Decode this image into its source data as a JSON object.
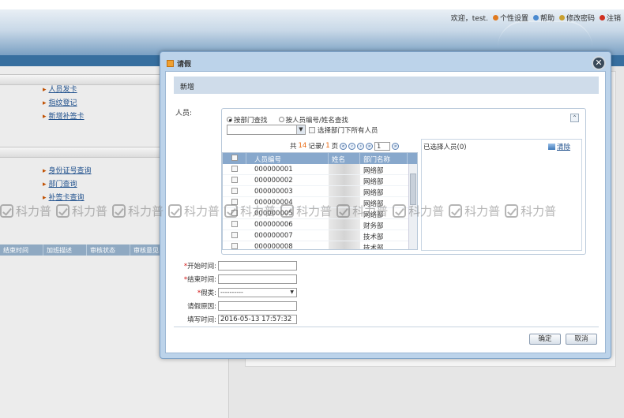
{
  "header": {
    "links": [
      {
        "label": "欢迎，test.",
        "icon": ""
      },
      {
        "label": "个性设置",
        "icon": "settings-icon"
      },
      {
        "label": "帮助",
        "icon": "help-icon"
      },
      {
        "label": "修改密码",
        "icon": "key-icon"
      },
      {
        "label": "注销",
        "icon": "logout-icon"
      }
    ]
  },
  "sidebar": {
    "group1": [
      "人员发卡",
      "指纹登记",
      "新增补签卡"
    ],
    "group2": [
      "身份证号查询",
      "部门查询",
      "补签卡查询"
    ]
  },
  "grid_header": [
    "结束时间",
    "加班描述",
    "审核状态",
    "审核意见"
  ],
  "watermark": {
    "text": "科力普",
    "count": 10
  },
  "dialog": {
    "title": "请假",
    "close_symbol": "✕",
    "section_title": "新增",
    "person_label": "人员:",
    "search": {
      "radio_by_dept": "按部门查找",
      "radio_by_id": "按人员编号/姓名查找",
      "dept_value": "",
      "select_all_label": "选择部门下所有人员",
      "pager": {
        "prefix": "共",
        "total": "14",
        "mid": "记录/",
        "pages": "1",
        "suffix": "页",
        "current_page": "1"
      },
      "columns": [
        "人员编号",
        "姓名",
        "部门名称"
      ],
      "rows": [
        {
          "id": "000000001",
          "name": "",
          "dept": "网络部"
        },
        {
          "id": "000000002",
          "name": "",
          "dept": "网络部"
        },
        {
          "id": "000000003",
          "name": "",
          "dept": "网络部"
        },
        {
          "id": "000000004",
          "name": "",
          "dept": "网络部"
        },
        {
          "id": "000000005",
          "name": "",
          "dept": "网络部"
        },
        {
          "id": "000000006",
          "name": "",
          "dept": "财务部"
        },
        {
          "id": "000000007",
          "name": "",
          "dept": "技术部"
        },
        {
          "id": "000000008",
          "name": "",
          "dept": "技术部"
        }
      ],
      "selected_title": "已选择人员(0)",
      "clear_label": "清除"
    },
    "form": {
      "start_label": "开始时间:",
      "start_value": "",
      "end_label": "结束时间:",
      "end_value": "",
      "type_label": "假类:",
      "type_value": "----------",
      "reason_label": "请假原因:",
      "reason_value": "",
      "fill_label": "填写时间:",
      "fill_value": "2016-05-13 17:57:32",
      "required_mark": "*"
    },
    "buttons": {
      "ok": "确定",
      "cancel": "取消"
    }
  },
  "colors": {
    "accent": "#376f9f",
    "pager_number": "#e8660c",
    "required": "#d01010"
  }
}
